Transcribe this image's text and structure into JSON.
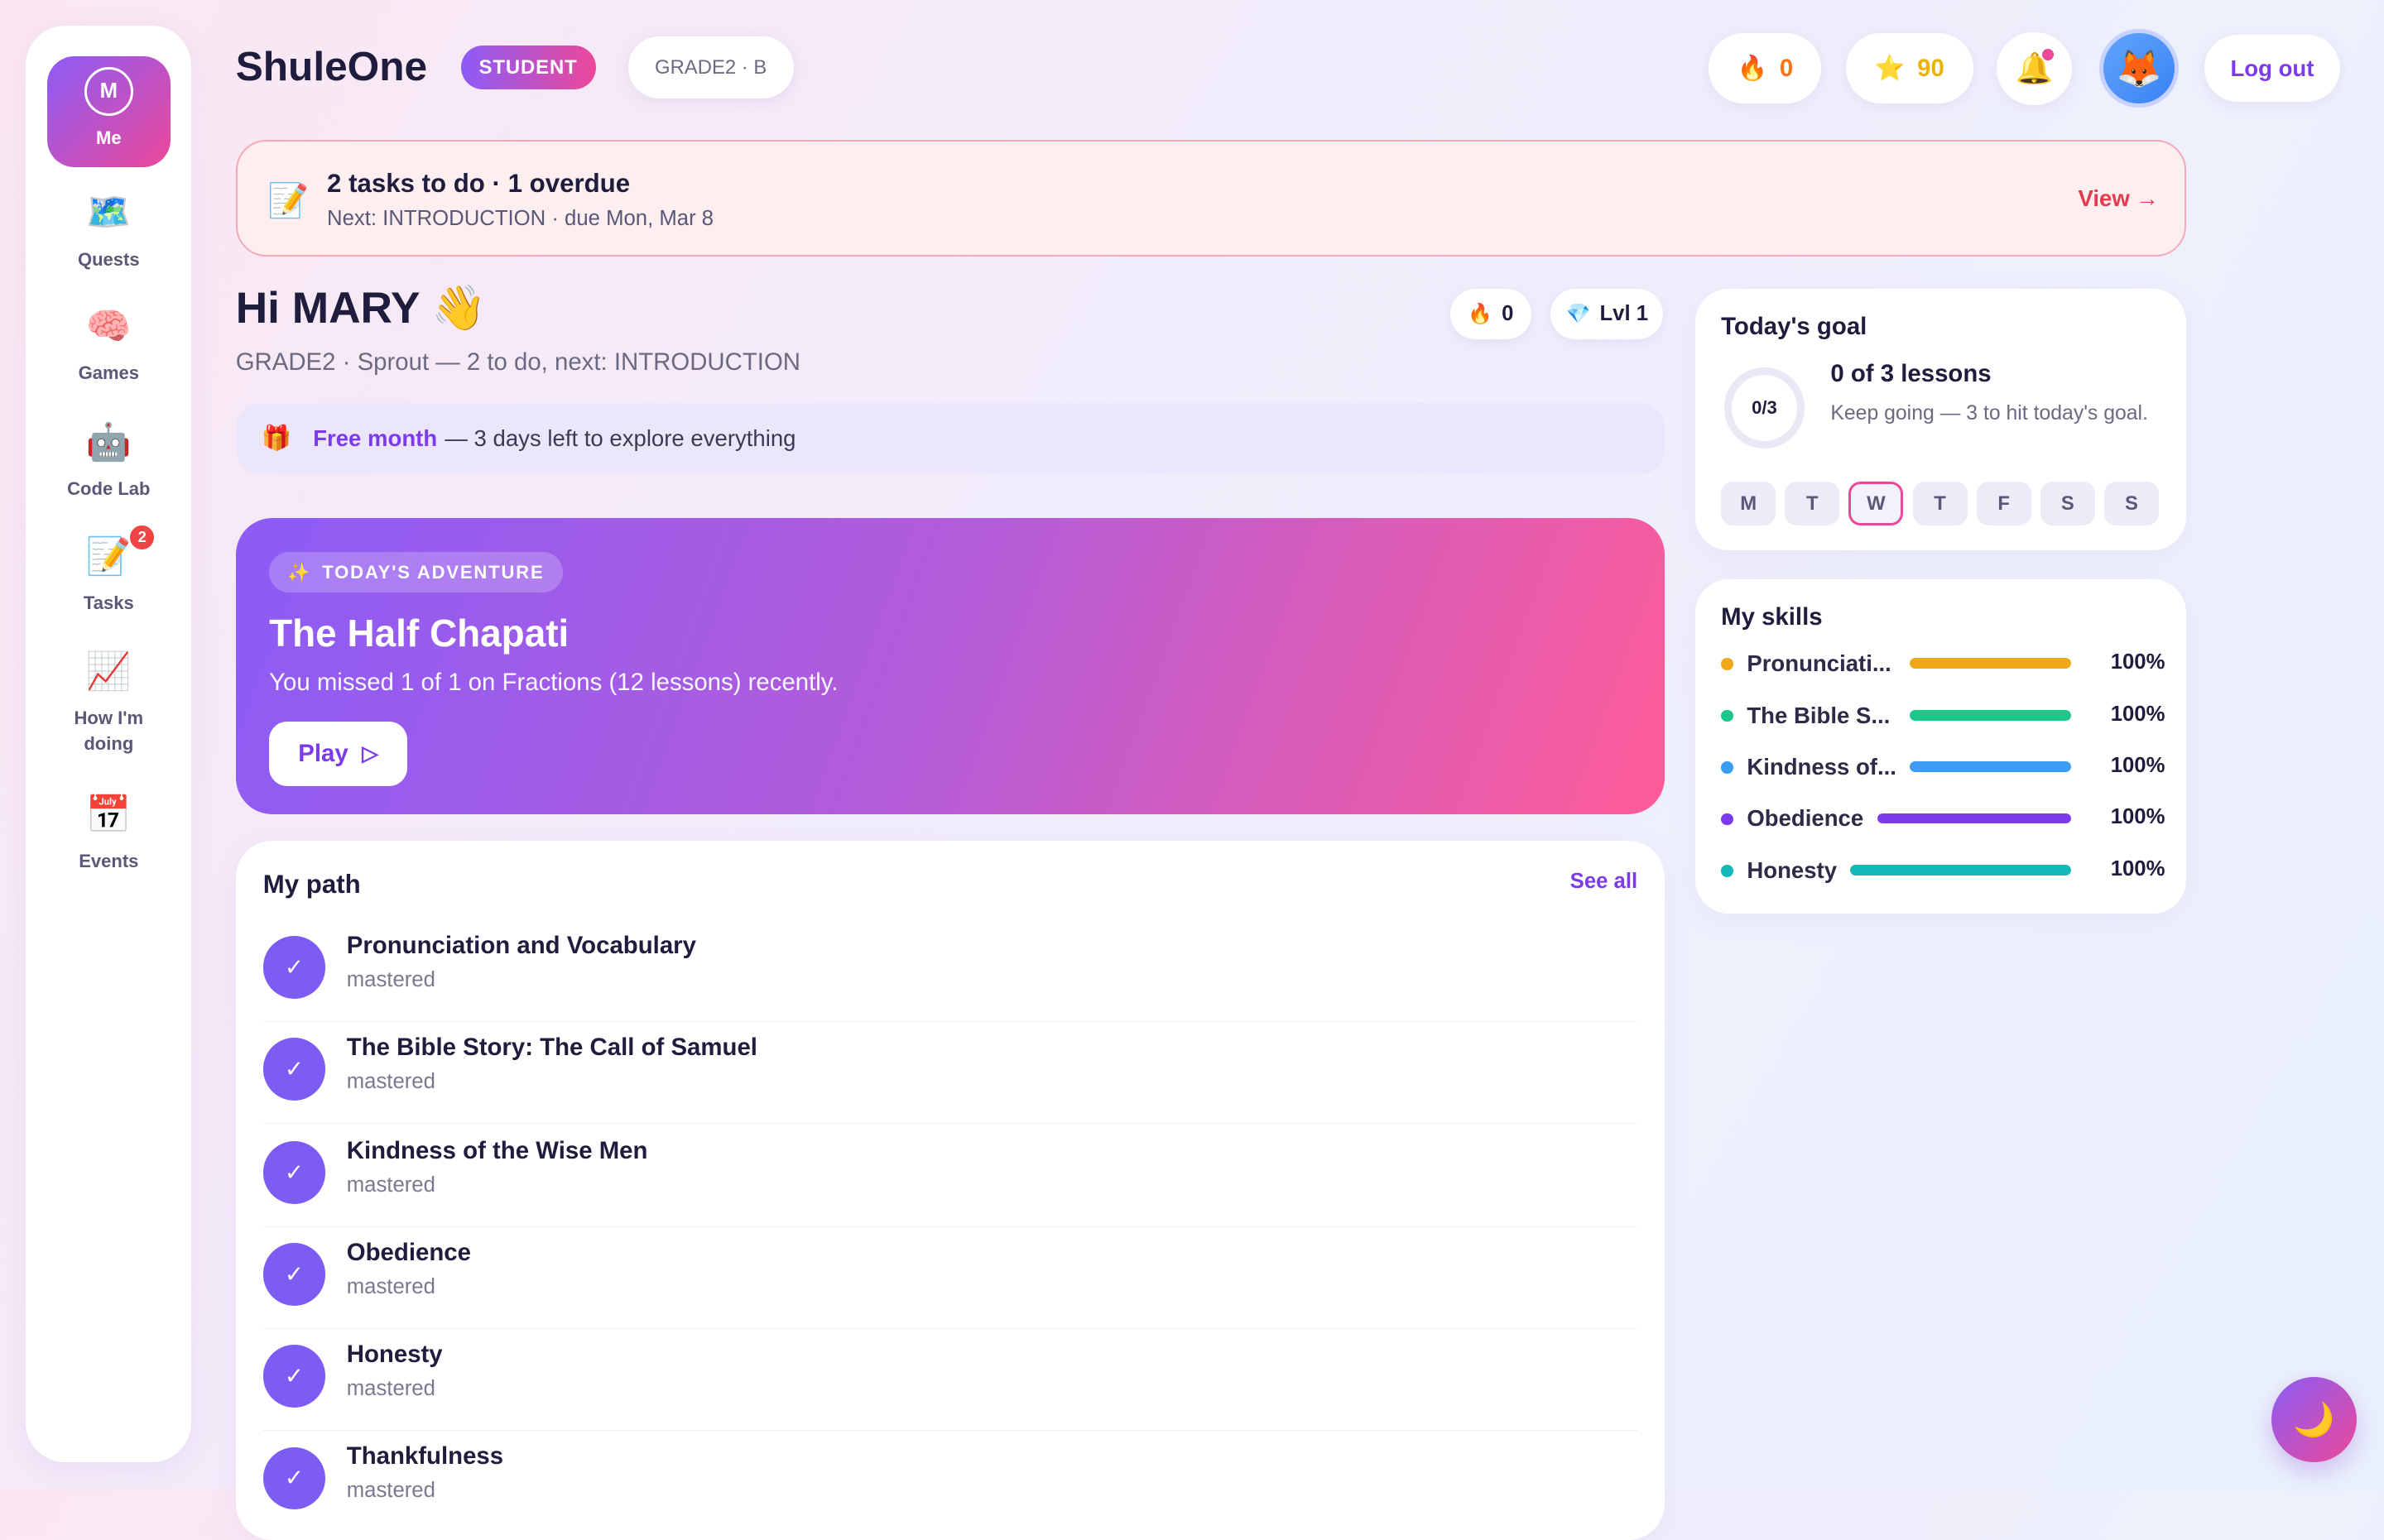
{
  "sidebar": {
    "me": {
      "initial": "M",
      "label": "Me"
    },
    "items": [
      {
        "icon": "🗺️",
        "label": "Quests"
      },
      {
        "icon": "🧠",
        "label": "Games"
      },
      {
        "icon": "🤖",
        "label": "Code Lab"
      },
      {
        "icon": "📝",
        "label": "Tasks",
        "badge": "2"
      },
      {
        "icon": "📈",
        "label": "How I'm doing"
      },
      {
        "icon": "📅",
        "label": "Events"
      }
    ]
  },
  "header": {
    "brand": "ShuleOne",
    "role": "STUDENT",
    "class": "GRADE2 · B",
    "streak": {
      "icon": "🔥",
      "value": "0"
    },
    "stars": {
      "icon": "⭐",
      "value": "90"
    },
    "bell_icon": "🔔",
    "avatar": "🦊",
    "logout": "Log out"
  },
  "tasks_banner": {
    "icon": "📝",
    "title": "2 tasks to do · 1 overdue",
    "subtitle": "Next: INTRODUCTION · due Mon, Mar 8",
    "view": "View →"
  },
  "greeting": {
    "title": "Hi MARY 👋",
    "subtitle": "GRADE2 · Sprout — 2 to do, next: INTRODUCTION",
    "streak_chip": {
      "icon": "🔥",
      "value": "0"
    },
    "level_chip": {
      "icon": "💎",
      "value": "Lvl 1"
    }
  },
  "free_month": {
    "icon": "🎁",
    "accent": "Free month",
    "text": "— 3 days left to explore everything"
  },
  "adventure": {
    "tag_icon": "✨",
    "tag": "TODAY'S ADVENTURE",
    "title": "The Half Chapati",
    "description": "You missed 1 of 1 on Fractions (12 lessons) recently.",
    "play_label": "Play",
    "play_icon": "▷"
  },
  "path": {
    "title": "My path",
    "see_all": "See all",
    "check_icon": "✓",
    "items": [
      {
        "name": "Pronunciation and Vocabulary",
        "status": "mastered"
      },
      {
        "name": "The Bible Story: The Call of Samuel",
        "status": "mastered"
      },
      {
        "name": "Kindness of the Wise Men",
        "status": "mastered"
      },
      {
        "name": "Obedience",
        "status": "mastered"
      },
      {
        "name": "Honesty",
        "status": "mastered"
      },
      {
        "name": "Thankfulness",
        "status": "mastered"
      }
    ]
  },
  "goal": {
    "title": "Today's goal",
    "ring": "0/3",
    "progress": 0,
    "main": "0 of 3 lessons",
    "sub": "Keep going — 3 to hit today's goal.",
    "days": [
      "M",
      "T",
      "W",
      "T",
      "F",
      "S",
      "S"
    ],
    "today_index": 2
  },
  "skills": {
    "title": "My skills",
    "items": [
      {
        "name": "Pronunciati...",
        "pct": "100%",
        "value": 1.0,
        "color": "#f0a818"
      },
      {
        "name": "The Bible S...",
        "pct": "100%",
        "value": 1.0,
        "color": "#1fc68a"
      },
      {
        "name": "Kindness of...",
        "pct": "100%",
        "value": 1.0,
        "color": "#3b9cf4"
      },
      {
        "name": "Obedience",
        "pct": "100%",
        "value": 1.0,
        "color": "#7c3aed"
      },
      {
        "name": "Honesty",
        "pct": "100%",
        "value": 1.0,
        "color": "#15b8b8"
      }
    ]
  },
  "theme_toggle_icon": "🌙"
}
